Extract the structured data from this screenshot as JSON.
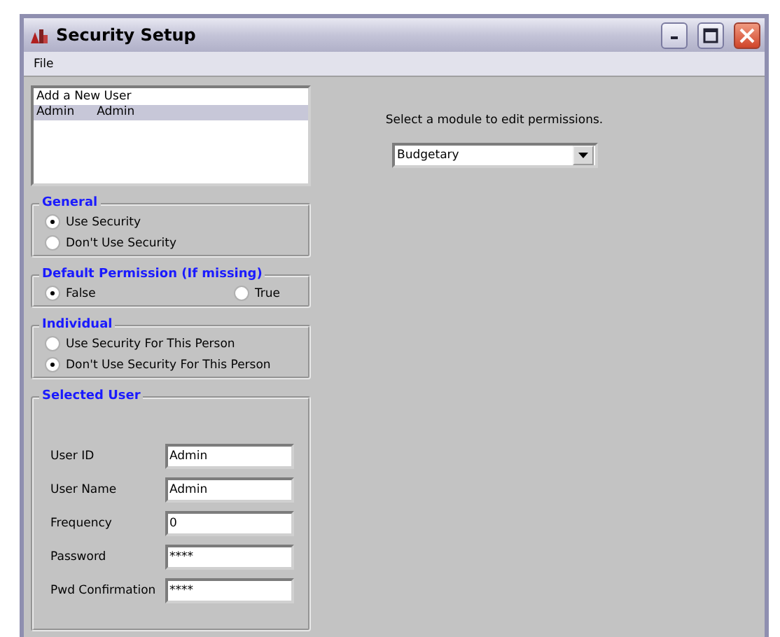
{
  "window": {
    "title": "Security Setup"
  },
  "menu": [
    "File"
  ],
  "users": [
    {
      "cells": [
        "Add a New User"
      ],
      "selected": false
    },
    {
      "cells": [
        "Admin",
        "Admin"
      ],
      "selected": true
    }
  ],
  "groups": [
    {
      "title": "General",
      "kind": "stacked",
      "options": [
        {
          "label": "Use Security",
          "selected": true
        },
        {
          "label": "Don't Use Security",
          "selected": false
        }
      ]
    },
    {
      "title": "Default Permission (If missing)",
      "kind": "inline",
      "options": [
        {
          "label": "False",
          "selected": true
        },
        {
          "label": "True",
          "selected": false
        }
      ]
    },
    {
      "title": "Individual",
      "kind": "stacked",
      "options": [
        {
          "label": "Use Security For This Person",
          "selected": false
        },
        {
          "label": "Don't Use Security For This Person",
          "selected": true
        }
      ]
    }
  ],
  "selected_user": {
    "title": "Selected User",
    "fields": [
      {
        "label": "User ID",
        "value": "Admin"
      },
      {
        "label": "User Name",
        "value": "Admin"
      },
      {
        "label": "Frequency",
        "value": "0"
      },
      {
        "label": "Password",
        "value": "****"
      },
      {
        "label": "Pwd Confirmation",
        "value": "****"
      }
    ]
  },
  "module": {
    "prompt": "Select a module to edit permissions.",
    "value": "Budgetary"
  }
}
